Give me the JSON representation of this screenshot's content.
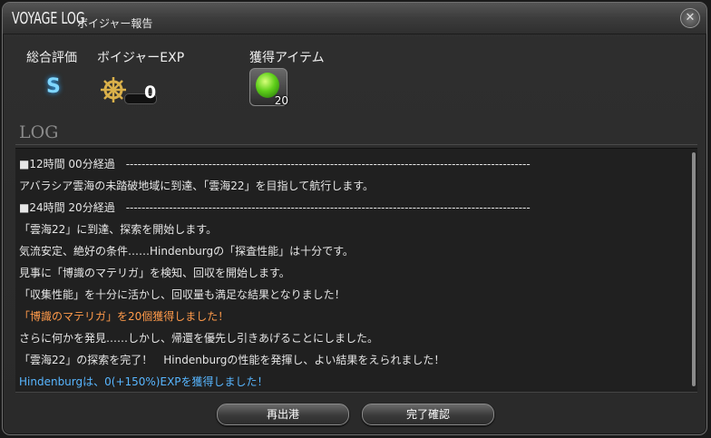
{
  "window": {
    "title_main": "VOYAGE LOG",
    "title_sub": "ボイジャー報告",
    "close_icon": "close-icon"
  },
  "summary": {
    "grade_label": "総合評価",
    "grade_value": "S",
    "exp_label": "ボイジャーEXP",
    "exp_value": "0",
    "exp_icon": "ship-wheel-icon",
    "items_label": "獲得アイテム",
    "item_icon": "green-materia-icon",
    "item_qty": "20"
  },
  "log": {
    "heading": "LOG",
    "lines": [
      "■12時間 00分経過　-------------------------------------------------------------------------------------------------------",
      "アバラシア雲海の未踏破地域に到達、「雲海22」を目指して航行します。",
      "■24時間 20分経過　-------------------------------------------------------------------------------------------------------",
      "「雲海22」に到達、探索を開始します。",
      "気流安定、絶好の条件……Hindenburgの「探査性能」は十分です。",
      "見事に「博識のマテリガ」を検知、回収を開始します。",
      "「収集性能」を十分に活かし、回収量も満足な結果となりました！",
      "「博識のマテリガ」を20個獲得しました！",
      "さらに何かを発見……しかし、帰還を優先し引きあげることにしました。",
      "「雲海22」の探索を完了！　Hindenburgの性能を発揮し、よい結果をえられました！",
      "Hindenburgは、0(+150%)EXPを獲得しました！"
    ]
  },
  "buttons": {
    "redeploy": "再出港",
    "confirm": "完了確認"
  },
  "colors": {
    "highlight": "#ff9a4a",
    "exp_text": "#58b6ff",
    "grade": "#7fd6ff"
  }
}
